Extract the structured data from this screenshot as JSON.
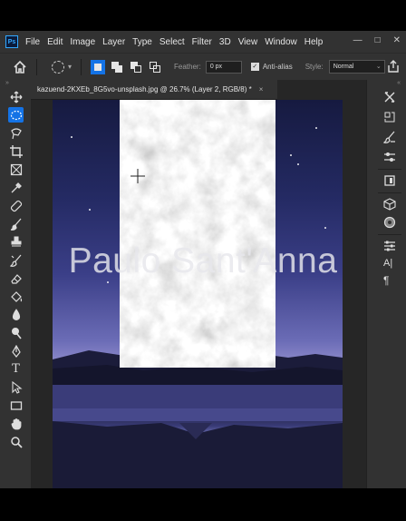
{
  "app": {
    "logo_text": "Ps",
    "menu": [
      "File",
      "Edit",
      "Image",
      "Layer",
      "Type",
      "Select",
      "Filter",
      "3D",
      "View",
      "Window",
      "Help"
    ],
    "window_controls": [
      "—",
      "□",
      "✕"
    ]
  },
  "options_bar": {
    "feather_label": "Feather:",
    "feather_value": "0 px",
    "antialias_label": "Anti-alias",
    "antialias_checked": true,
    "style_label": "Style:",
    "style_value": "Normal"
  },
  "document": {
    "tab_title": "kazuend-2KXEb_8G5vo-unsplash.jpg @ 26.7% (Layer 2, RGB/8) *",
    "close_glyph": "×"
  },
  "watermark": "Paulo Sant'Anna",
  "colors": {
    "accent": "#1473e6",
    "panel_bg": "#323232",
    "canvas_bg": "#262626"
  },
  "tools": [
    "move-tool",
    "elliptical-marquee-tool",
    "lasso-tool",
    "crop-tool",
    "frame-tool",
    "eyedropper-tool",
    "healing-brush-tool",
    "brush-tool",
    "clone-stamp-tool",
    "history-brush-tool",
    "eraser-tool",
    "paint-bucket-tool",
    "blur-tool",
    "dodge-tool",
    "pen-tool",
    "type-tool",
    "path-selection-tool",
    "rectangle-tool",
    "hand-tool",
    "zoom-tool"
  ],
  "type_tool_glyph": "T",
  "right_panel_icons": [
    "tools-preset-icon",
    "history-icon",
    "brush-settings-icon",
    "adjustments-icon",
    "libraries-icon",
    "3d-icon",
    "color-icon",
    "properties-icon",
    "character-icon",
    "paragraph-icon"
  ],
  "character_glyph": "A|",
  "paragraph_glyph": "¶",
  "collapse_glyphs": {
    "left": "»",
    "right": "«"
  }
}
